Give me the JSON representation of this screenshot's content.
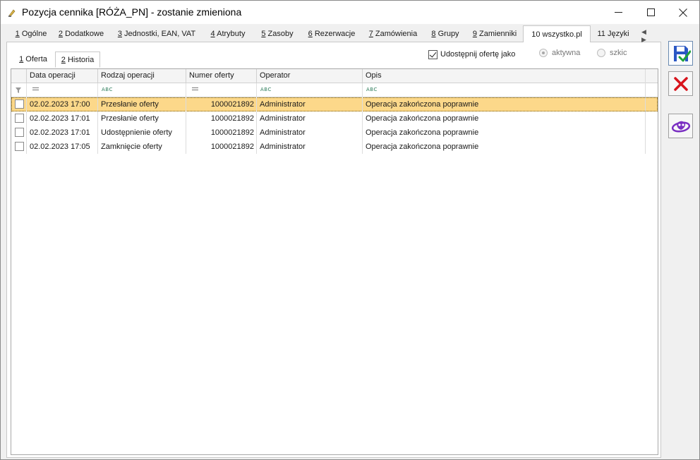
{
  "window": {
    "title": "Pozycja cennika [RÓŻA_PN] - zostanie zmieniona",
    "minimize": "—",
    "maximize": "☐",
    "close": "✕"
  },
  "main_tabs": [
    {
      "num": "1",
      "label": " Ogólne"
    },
    {
      "num": "2",
      "label": " Dodatkowe"
    },
    {
      "num": "3",
      "label": " Jednostki, EAN, VAT"
    },
    {
      "num": "4",
      "label": " Atrybuty"
    },
    {
      "num": "5",
      "label": " Zasoby"
    },
    {
      "num": "6",
      "label": " Rezerwacje"
    },
    {
      "num": "7",
      "label": " Zamówienia"
    },
    {
      "num": "8",
      "label": " Grupy"
    },
    {
      "num": "9",
      "label": " Zamienniki"
    },
    {
      "num": "10",
      "label": " wszystko.pl"
    },
    {
      "num": "11",
      "label": " Języki"
    }
  ],
  "tab_scroll": "◀ ▶",
  "sub_tabs": [
    {
      "num": "1",
      "label": " Oferta"
    },
    {
      "num": "2",
      "label": " Historia"
    }
  ],
  "share": {
    "label": "Udostępnij ofertę jako",
    "checked": true,
    "options": [
      {
        "label": "aktywna",
        "selected": true
      },
      {
        "label": "szkic",
        "selected": false
      }
    ]
  },
  "grid": {
    "columns": [
      "Data operacji",
      "Rodzaj operacji",
      "Numer oferty",
      "Operator",
      "Opis"
    ],
    "filter_text_marker": "ABC",
    "rows": [
      {
        "date": "02.02.2023 17:00",
        "type": "Przesłanie oferty",
        "number": "1000021892",
        "operator": "Administrator",
        "desc": "Operacja zakończona poprawnie",
        "selected": true
      },
      {
        "date": "02.02.2023 17:01",
        "type": "Przesłanie oferty",
        "number": "1000021892",
        "operator": "Administrator",
        "desc": "Operacja zakończona poprawnie",
        "selected": false
      },
      {
        "date": "02.02.2023 17:01",
        "type": "Udostępnienie oferty",
        "number": "1000021892",
        "operator": "Administrator",
        "desc": "Operacja zakończona poprawnie",
        "selected": false
      },
      {
        "date": "02.02.2023 17:05",
        "type": "Zamknięcie oferty",
        "number": "1000021892",
        "operator": "Administrator",
        "desc": "Operacja zakończona poprawnie",
        "selected": false
      }
    ]
  },
  "side_buttons": [
    {
      "name": "save-icon"
    },
    {
      "name": "cancel-icon"
    },
    {
      "name": "web-icon"
    }
  ],
  "colors": {
    "selected_row": "#fcd88a",
    "save_blue": "#2a57c4",
    "check_green": "#1fa33a",
    "cancel_red": "#d8141c",
    "web_purple": "#7a2fc2"
  }
}
